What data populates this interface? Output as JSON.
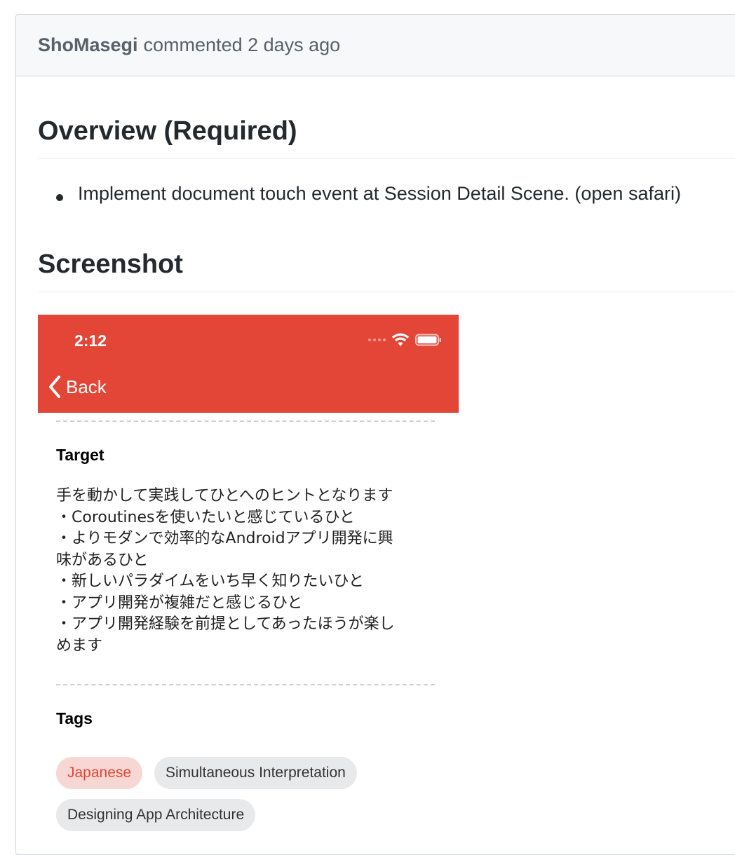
{
  "comment": {
    "author": "ShoMasegi",
    "meta": "commented 2 days ago"
  },
  "body": {
    "overview_heading": "Overview (Required)",
    "overview_items": [
      "Implement document touch event at Session Detail Scene. (open safari)"
    ],
    "screenshot_heading": "Screenshot"
  },
  "phone": {
    "time": "2:12",
    "back_label": "Back",
    "accent_color": "#e34536",
    "target_title": "Target",
    "target_lines": [
      "手を動かして実践してひとへのヒントとなります",
      "・Coroutinesを使いたいと感じているひと",
      "・よりモダンで効率的なAndroidアプリ開発に興",
      "味があるひと",
      "・新しいパラダイムをいち早く知りたいひと",
      "・アプリ開発が複雑だと感じるひと",
      "・アプリ開発経験を前提としてあったほうが楽し",
      "めます"
    ],
    "tags_title": "Tags",
    "tags": [
      "Japanese",
      "Simultaneous Interpretation",
      "Designing App Architecture"
    ]
  }
}
